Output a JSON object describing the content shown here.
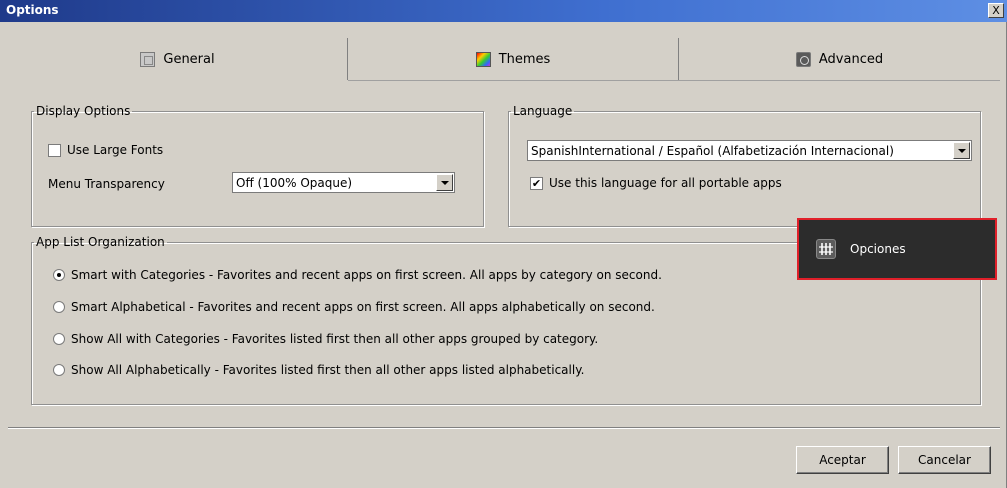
{
  "window": {
    "title": "Options",
    "close_glyph": "X"
  },
  "tabs": [
    {
      "label": "General",
      "icon": "general-icon",
      "active": true
    },
    {
      "label": "Themes",
      "icon": "themes-icon",
      "active": false
    },
    {
      "label": "Advanced",
      "icon": "advanced-icon",
      "active": false
    }
  ],
  "display_options": {
    "legend": "Display Options",
    "large_fonts_label": "Use Large Fonts",
    "large_fonts_checked": false,
    "menu_transparency_label": "Menu Transparency",
    "menu_transparency_value": "Off (100% Opaque)"
  },
  "language": {
    "legend": "Language",
    "selected": "SpanishInternational / Español (Alfabetización Internacional)",
    "portable_label": "Use this language for all portable apps",
    "portable_checked": true
  },
  "app_list": {
    "legend": "App List Organization",
    "options": [
      {
        "label": "Smart with Categories - Favorites and recent apps on first screen.  All apps by category on second.",
        "selected": true
      },
      {
        "label": "Smart Alphabetical - Favorites and recent apps on first screen.  All apps alphabetically on second.",
        "selected": false
      },
      {
        "label": "Show All with Categories - Favorites listed first then all other apps grouped by category.",
        "selected": false
      },
      {
        "label": "Show All Alphabetically - Favorites listed first then all other apps listed alphabetically.",
        "selected": false
      }
    ]
  },
  "popup": {
    "label": "Opciones",
    "icon": "options-icon",
    "highlight_color": "#e0202a"
  },
  "buttons": {
    "ok": "Aceptar",
    "cancel": "Cancelar"
  }
}
